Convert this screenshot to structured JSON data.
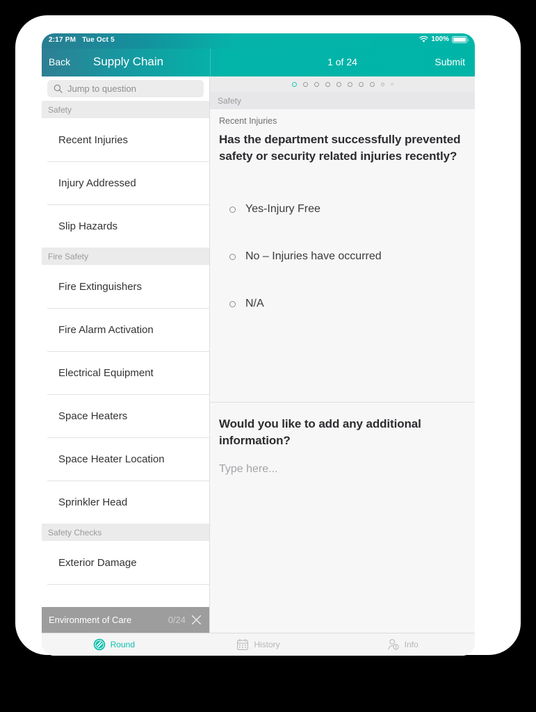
{
  "status_bar": {
    "time": "2:17 PM",
    "date": "Tue Oct 5",
    "battery_label": "100%",
    "wifi_icon": "wifi-icon",
    "battery_icon": "battery-icon"
  },
  "nav": {
    "back_label": "Back",
    "title": "Supply Chain",
    "counter": "1 of 24",
    "submit_label": "Submit"
  },
  "search": {
    "placeholder": "Jump to question",
    "icon": "search-icon"
  },
  "sidebar": {
    "groups": [
      {
        "section": "Safety",
        "items": [
          {
            "label": "Recent Injuries"
          },
          {
            "label": "Injury Addressed"
          },
          {
            "label": "Slip Hazards"
          }
        ]
      },
      {
        "section": "Fire Safety",
        "items": [
          {
            "label": "Fire Extinguishers"
          },
          {
            "label": "Fire Alarm Activation"
          },
          {
            "label": "Electrical Equipment"
          },
          {
            "label": "Space Heaters"
          },
          {
            "label": "Space Heater Location"
          },
          {
            "label": "Sprinkler Head"
          }
        ]
      },
      {
        "section": "Safety Checks",
        "items": [
          {
            "label": "Exterior Damage"
          },
          {
            "label": ""
          }
        ]
      }
    ]
  },
  "round_bar": {
    "title": "Environment of Care",
    "progress": "0/24",
    "close_icon": "close-icon"
  },
  "pager": {
    "total_visible_dots": 10,
    "active_index": 0
  },
  "content": {
    "context_label": "Safety",
    "question_label": "Recent Injuries",
    "question_text": "Has the department successfully prevented safety or security related injuries recently?",
    "options": [
      {
        "label": "Yes-Injury Free",
        "selected": false
      },
      {
        "label": "No – Injuries have occurred",
        "selected": false
      },
      {
        "label": "N/A",
        "selected": false
      }
    ],
    "followup_question": "Would you like to add any additional information?",
    "followup_placeholder": "Type here..."
  },
  "tabs": [
    {
      "label": "Round",
      "icon": "round-icon",
      "active": true
    },
    {
      "label": "History",
      "icon": "calendar-icon",
      "active": false
    },
    {
      "label": "Info",
      "icon": "person-info-icon",
      "active": false
    }
  ],
  "colors": {
    "accent_teal": "#00b5a8",
    "status_gradient_left": "#2a7d92",
    "tab_active": "#0fbfae",
    "eoc_bar": "#9d9d9d"
  }
}
